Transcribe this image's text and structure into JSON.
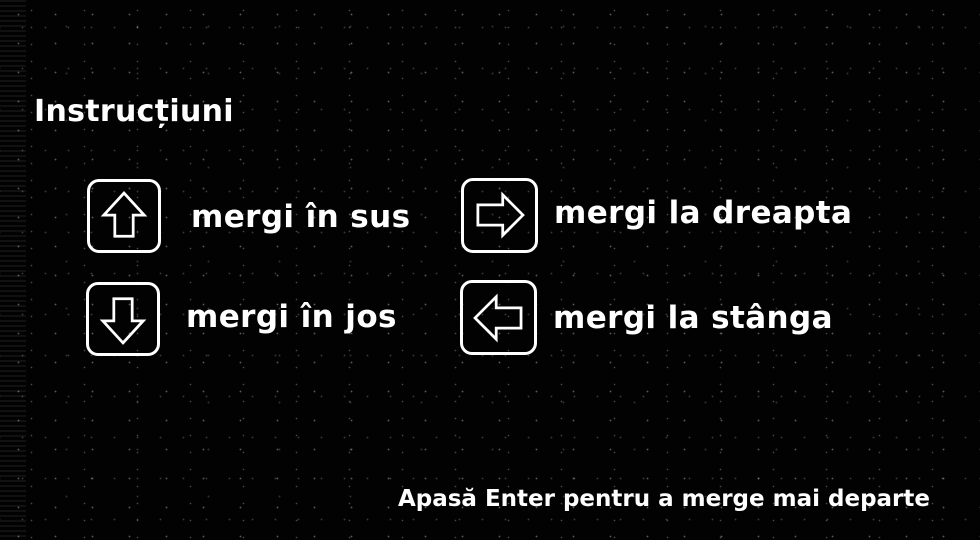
{
  "title": "Instrucțiuni",
  "controls": [
    {
      "key": "up",
      "icon": "arrow-up-icon",
      "label": "mergi în sus"
    },
    {
      "key": "down",
      "icon": "arrow-down-icon",
      "label": "mergi în jos"
    },
    {
      "key": "right",
      "icon": "arrow-right-icon",
      "label": "mergi la dreapta"
    },
    {
      "key": "left",
      "icon": "arrow-left-icon",
      "label": "mergi la stânga"
    }
  ],
  "footer": "Apasă Enter pentru a merge mai departe",
  "colors": {
    "background": "#020202",
    "text": "#ffffff"
  }
}
